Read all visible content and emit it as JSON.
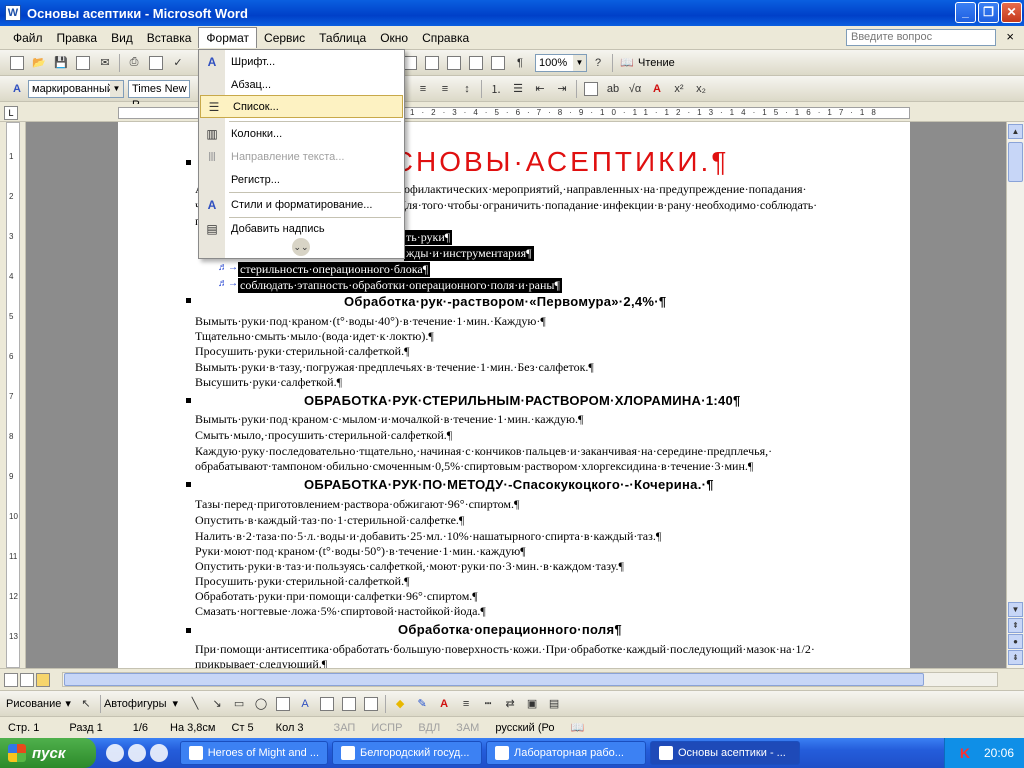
{
  "window": {
    "title": "Основы асептики - Microsoft Word",
    "app_icon": "W"
  },
  "menubar": {
    "items": [
      "Файл",
      "Правка",
      "Вид",
      "Вставка",
      "Формат",
      "Сервис",
      "Таблица",
      "Окно",
      "Справка"
    ],
    "ask_placeholder": "Введите вопрос"
  },
  "toolbar1": {
    "zoom": "100%",
    "reading": "Чтение"
  },
  "toolbar2": {
    "style": "маркированный",
    "font": "Times New R"
  },
  "format_menu": {
    "items": [
      {
        "label": "Шрифт...",
        "icon": "font-icon"
      },
      {
        "label": "Абзац...",
        "icon": "paragraph-icon"
      },
      {
        "label": "Список...",
        "icon": "list-icon",
        "highlighted": true
      },
      {
        "label": "Колонки...",
        "icon": "columns-icon"
      },
      {
        "label": "Направление текста...",
        "icon": "text-direction-icon",
        "disabled": true
      },
      {
        "label": "Регистр...",
        "icon": ""
      },
      {
        "label": "Стили и форматирование...",
        "icon": "styles-icon"
      },
      {
        "label": "Добавить надпись",
        "icon": "textbox-icon"
      }
    ]
  },
  "document": {
    "title": "ОСНОВЫ·АСЕПТИКИ.¶",
    "intro": [
      "А",
      "ч",
      "п"
    ],
    "intro_right1": "рофилактических·мероприятий,·направленных·на·предупреждение·попадания·",
    "intro_right2": "Для·того·чтобы·ограничить·попадание·инфекции·в·рану·необходимо·соблюдать·",
    "selected": [
      "ть·руки¶",
      "жды·и·инструментария¶",
      "стерильность·операционного·блока¶",
      "соблюдать·этапность·обработки·операционного·поля·и·раны¶"
    ],
    "sections": [
      {
        "heading": "Обработка·рук·-раствором·«Первомура»·2,4%·¶",
        "lines": [
          "Вымыть·руки·под·краном·(t°·воды·40°)·в·течение·1·мин.·Каждую·¶",
          "Тщательно·смыть·мыло·(вода·идет·к·локтю).¶",
          "Просушить·руки·стерильной·салфеткой.¶",
          "Вымыть·руки·в·тазу,·погружая·предплечьях·в·течение·1·мин.·Без·салфеток.¶",
          "Высушить·руки·салфеткой.¶"
        ]
      },
      {
        "heading": "ОБРАБОТКА·РУК·СТЕРИЛЬНЫМ·РАСТВОРОМ·ХЛОРАМИНА·1:40¶",
        "lines": [
          "Вымыть·руки·под·краном·с·мылом·и·мочалкой·в·течение·1·мин.·каждую.¶",
          "Смыть·мыло,·просушить·стерильной·салфеткой.¶",
          "Каждую·руку·последовательно·тщательно,·начиная·с·кончиков·пальцев·и·заканчивая·на·середине·предплечья,·",
          "обрабатывают·тампоном·обильно·смоченным·0,5%·спиртовым·раствором·хлоргексидина·в·течение·3·мин.¶"
        ]
      },
      {
        "heading": "ОБРАБОТКА·РУК·ПО·МЕТОДУ·-Спасокукоцкого·-·Кочерина.·¶",
        "lines": [
          "Тазы·перед·приготовлением·раствора·обжигают·96°·спиртом.¶",
          "Опустить·в·каждый·таз·по·1·стерильной·салфетке.¶",
          "Налить·в·2·таза·по·5·л.·воды·и·добавить·25·мл.·10%·нашатырного·спирта·в·каждый·таз.¶",
          "Руки·моют·под·краном·(t°·воды·50°)·в·течение·1·мин.·каждую¶",
          "Опустить·руки·в·таз·и·пользуясь·салфеткой,·моют·руки·по·3·мин.·в·каждом·тазу.¶",
          "Просушить·руки·стерильной·салфеткой.¶",
          "Обработать·руки·при·помощи·салфетки·96°·спиртом.¶",
          "Смазать·ногтевые·ложа·5%·спиртовой·настойкой·йода.¶"
        ]
      },
      {
        "heading": "Обработка·операционного·поля¶",
        "lines": [
          "При·помощи·антисептика·обработать·большую·поверхность·кожи.·При·обработке·каждый·последующий·мазок·на·1/2·",
          "прикрывает·следующий.¶"
        ]
      }
    ]
  },
  "drawbar": {
    "draw": "Рисование",
    "autoshapes": "Автофигуры"
  },
  "status": {
    "page": "Стр. 1",
    "section": "Разд 1",
    "pages": "1/6",
    "at": "На 3,8см",
    "line": "Ст 5",
    "col": "Кол 3",
    "rec": "ЗАП",
    "trk": "ИСПР",
    "ext": "ВДЛ",
    "ovr": "ЗАМ",
    "lang": "русский (Ро"
  },
  "taskbar": {
    "start": "пуск",
    "tasks": [
      "Heroes of Might and ...",
      "Белгородский госуд...",
      "Лабораторная рабо...",
      "Основы асептики - ..."
    ],
    "clock": "20:06"
  }
}
